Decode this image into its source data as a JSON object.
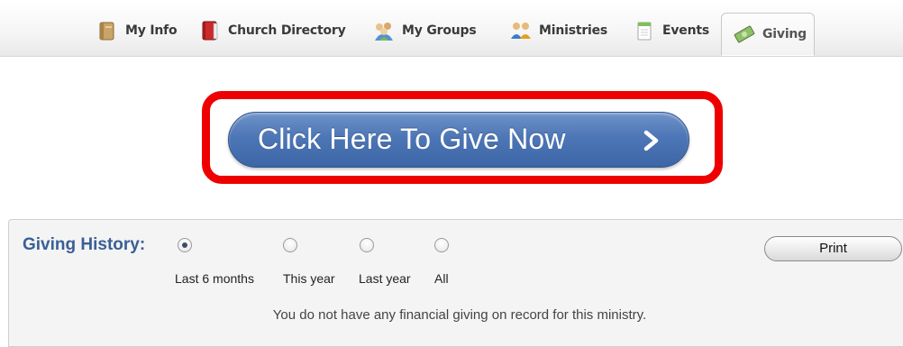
{
  "tabs": [
    {
      "label": "My Info",
      "icon": "book-icon"
    },
    {
      "label": "Church Directory",
      "icon": "red-book-icon"
    },
    {
      "label": "My Groups",
      "icon": "group-people-icon"
    },
    {
      "label": "Ministries",
      "icon": "people-pair-icon"
    },
    {
      "label": "Events",
      "icon": "notepad-icon"
    },
    {
      "label": "Giving",
      "icon": "money-icon",
      "active": true
    }
  ],
  "give": {
    "label": "Click Here To Give Now",
    "chevron_icon": "chevron-right-icon",
    "accent": "#4d76b6",
    "highlight_color": "#ee0000"
  },
  "history": {
    "title": "Giving History:",
    "options": [
      {
        "label": "Last 6 months",
        "selected": true
      },
      {
        "label": "This year",
        "selected": false
      },
      {
        "label": "Last year",
        "selected": false
      },
      {
        "label": "All",
        "selected": false
      }
    ],
    "print_label": "Print",
    "empty_message": "You do not have any financial giving on record for this ministry."
  }
}
